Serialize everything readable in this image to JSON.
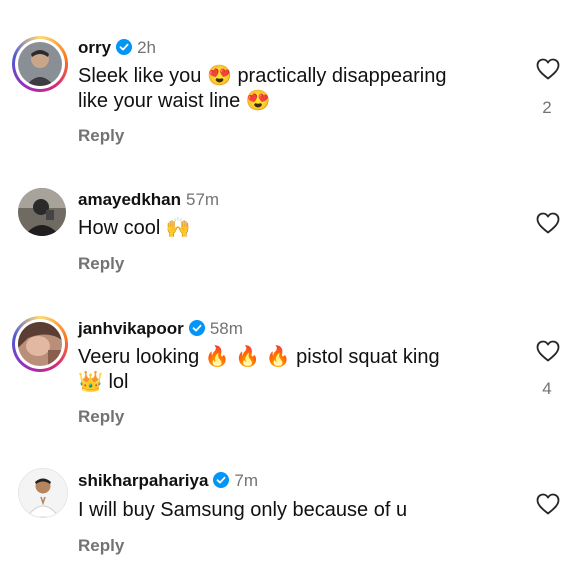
{
  "comments": [
    {
      "username": "orry",
      "verified": true,
      "time": "2h",
      "text_a": "Sleek like you",
      "emoji_a": "😍",
      "text_b": "practically disappearing",
      "text_c": "like your waist line",
      "emoji_b": "😍",
      "reply_label": "Reply",
      "likes": "2"
    },
    {
      "username": "amayedkhan",
      "verified": false,
      "time": "57m",
      "text_a": "How cool",
      "emoji_a": "🙌",
      "reply_label": "Reply"
    },
    {
      "username": "janhvikapoor",
      "verified": true,
      "time": "58m",
      "text_a": "Veeru looking",
      "emoji_a": "🔥",
      "emoji_b": "🔥",
      "emoji_c": "🔥",
      "text_b": "pistol squat king",
      "emoji_d": "👑",
      "text_c": "lol",
      "reply_label": "Reply",
      "likes": "4"
    },
    {
      "username": "shikharpahariya",
      "verified": true,
      "time": "7m",
      "text_a": "I will buy Samsung only because of u",
      "reply_label": "Reply"
    }
  ],
  "icons": {
    "like": "heart-outline-icon",
    "verified": "verified-badge-icon"
  },
  "colors": {
    "verified": "#0095f6",
    "muted": "#737373",
    "text": "#111111"
  }
}
